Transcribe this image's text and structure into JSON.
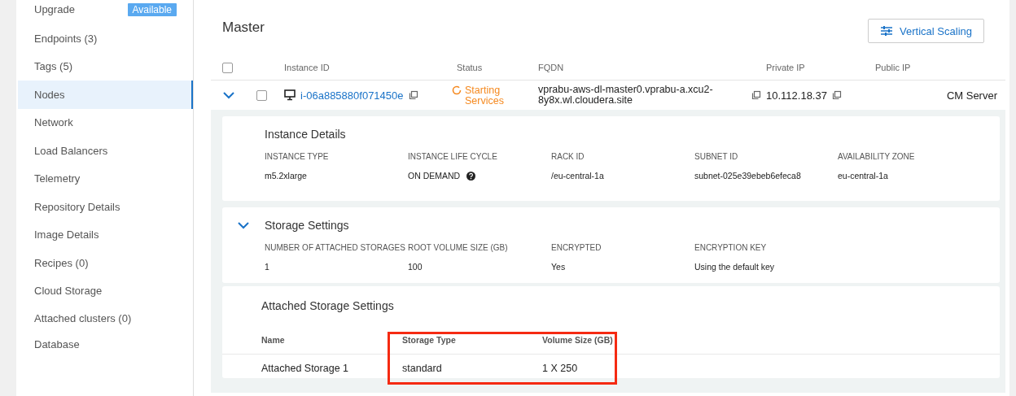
{
  "sidebar": {
    "items": [
      {
        "label": "Upgrade",
        "badge": "Available",
        "selected": false
      },
      {
        "label": "Endpoints (3)",
        "selected": false
      },
      {
        "label": "Tags (5)",
        "selected": false
      },
      {
        "label": "Nodes",
        "selected": true
      },
      {
        "label": "Network",
        "selected": false
      },
      {
        "label": "Load Balancers",
        "selected": false
      },
      {
        "label": "Telemetry",
        "selected": false
      },
      {
        "label": "Repository Details",
        "selected": false
      },
      {
        "label": "Image Details",
        "selected": false
      },
      {
        "label": "Recipes (0)",
        "selected": false
      },
      {
        "label": "Cloud Storage",
        "selected": false
      },
      {
        "label": "Attached clusters (0)",
        "selected": false
      },
      {
        "label": "Database",
        "selected": false
      }
    ]
  },
  "group": {
    "title": "Master",
    "action": "Vertical Scaling"
  },
  "table": {
    "all_checked": false,
    "columns": [
      "Instance ID",
      "Status",
      "FQDN",
      "Private IP",
      "Public IP"
    ],
    "rows": [
      {
        "expanded": true,
        "checked": false,
        "instance_id": "i-06a885880f071450e",
        "status": "Starting Services",
        "fqdn": "vprabu-aws-dl-master0.vprabu-a.xcu2-8y8x.wl.cloudera.site",
        "private_ip": "10.112.18.37",
        "role": "CM Server"
      }
    ]
  },
  "instance_details": {
    "title": "Instance Details",
    "fields": [
      {
        "label": "INSTANCE TYPE",
        "value": "m5.2xlarge"
      },
      {
        "label": "INSTANCE LIFE CYCLE",
        "value": "ON DEMAND",
        "help": true
      },
      {
        "label": "RACK ID",
        "value": "/eu-central-1a"
      },
      {
        "label": "SUBNET ID",
        "value": "subnet-025e39ebeb6efeca8"
      },
      {
        "label": "AVAILABILITY ZONE",
        "value": "eu-central-1a"
      }
    ]
  },
  "storage_settings": {
    "title": "Storage Settings",
    "expanded": true,
    "fields": [
      {
        "label": "NUMBER OF ATTACHED STORAGES",
        "value": "1"
      },
      {
        "label": "ROOT VOLUME SIZE (GB)",
        "value": "100"
      },
      {
        "label": "ENCRYPTED",
        "value": "Yes"
      },
      {
        "label": "ENCRYPTION KEY",
        "value": "Using the default key"
      }
    ]
  },
  "attached_storage": {
    "title": "Attached Storage Settings",
    "columns": [
      {
        "label": "Name",
        "highlighted": false
      },
      {
        "label": "Storage Type",
        "highlighted": true
      },
      {
        "label": "Volume Size (GB)",
        "highlighted": true
      }
    ],
    "rows": [
      [
        "Attached Storage 1",
        "standard",
        "1 X 250"
      ]
    ]
  }
}
